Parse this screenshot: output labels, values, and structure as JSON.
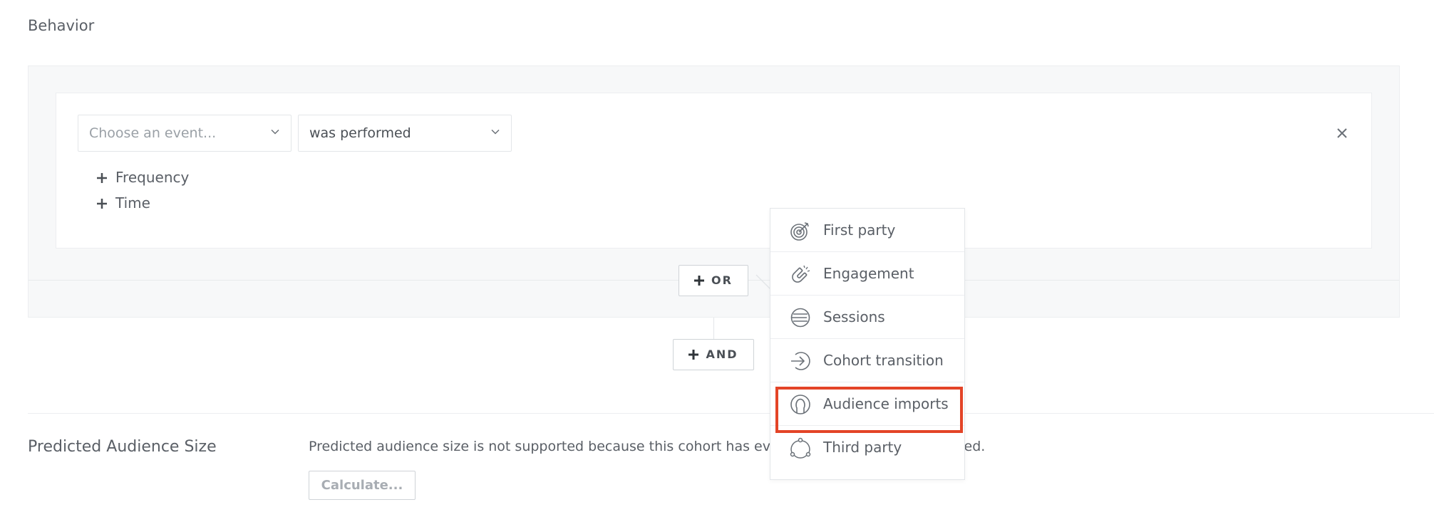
{
  "section": {
    "title": "Behavior"
  },
  "condition": {
    "event_select": {
      "placeholder": "Choose an event..."
    },
    "performed_select": {
      "value": "was performed"
    },
    "add_options": [
      {
        "label": "Frequency"
      },
      {
        "label": "Time"
      }
    ]
  },
  "buttons": {
    "or_label": "OR",
    "and_label": "AND"
  },
  "menu": {
    "items": [
      {
        "label": "First party",
        "icon": "target-icon"
      },
      {
        "label": "Engagement",
        "icon": "magnet-icon"
      },
      {
        "label": "Sessions",
        "icon": "sessions-icon"
      },
      {
        "label": "Cohort transition",
        "icon": "arrow-in-icon"
      },
      {
        "label": "Audience imports",
        "icon": "person-icon"
      },
      {
        "label": "Third party",
        "icon": "third-party-icon"
      }
    ],
    "highlighted_index": 4,
    "highlight_color": "#e34427"
  },
  "predicted": {
    "label": "Predicted Audience Size",
    "message_start": "Predicted audience size is not supported because this cohort has ev",
    "message_end": "ected.",
    "calculate_label": "Calculate..."
  }
}
